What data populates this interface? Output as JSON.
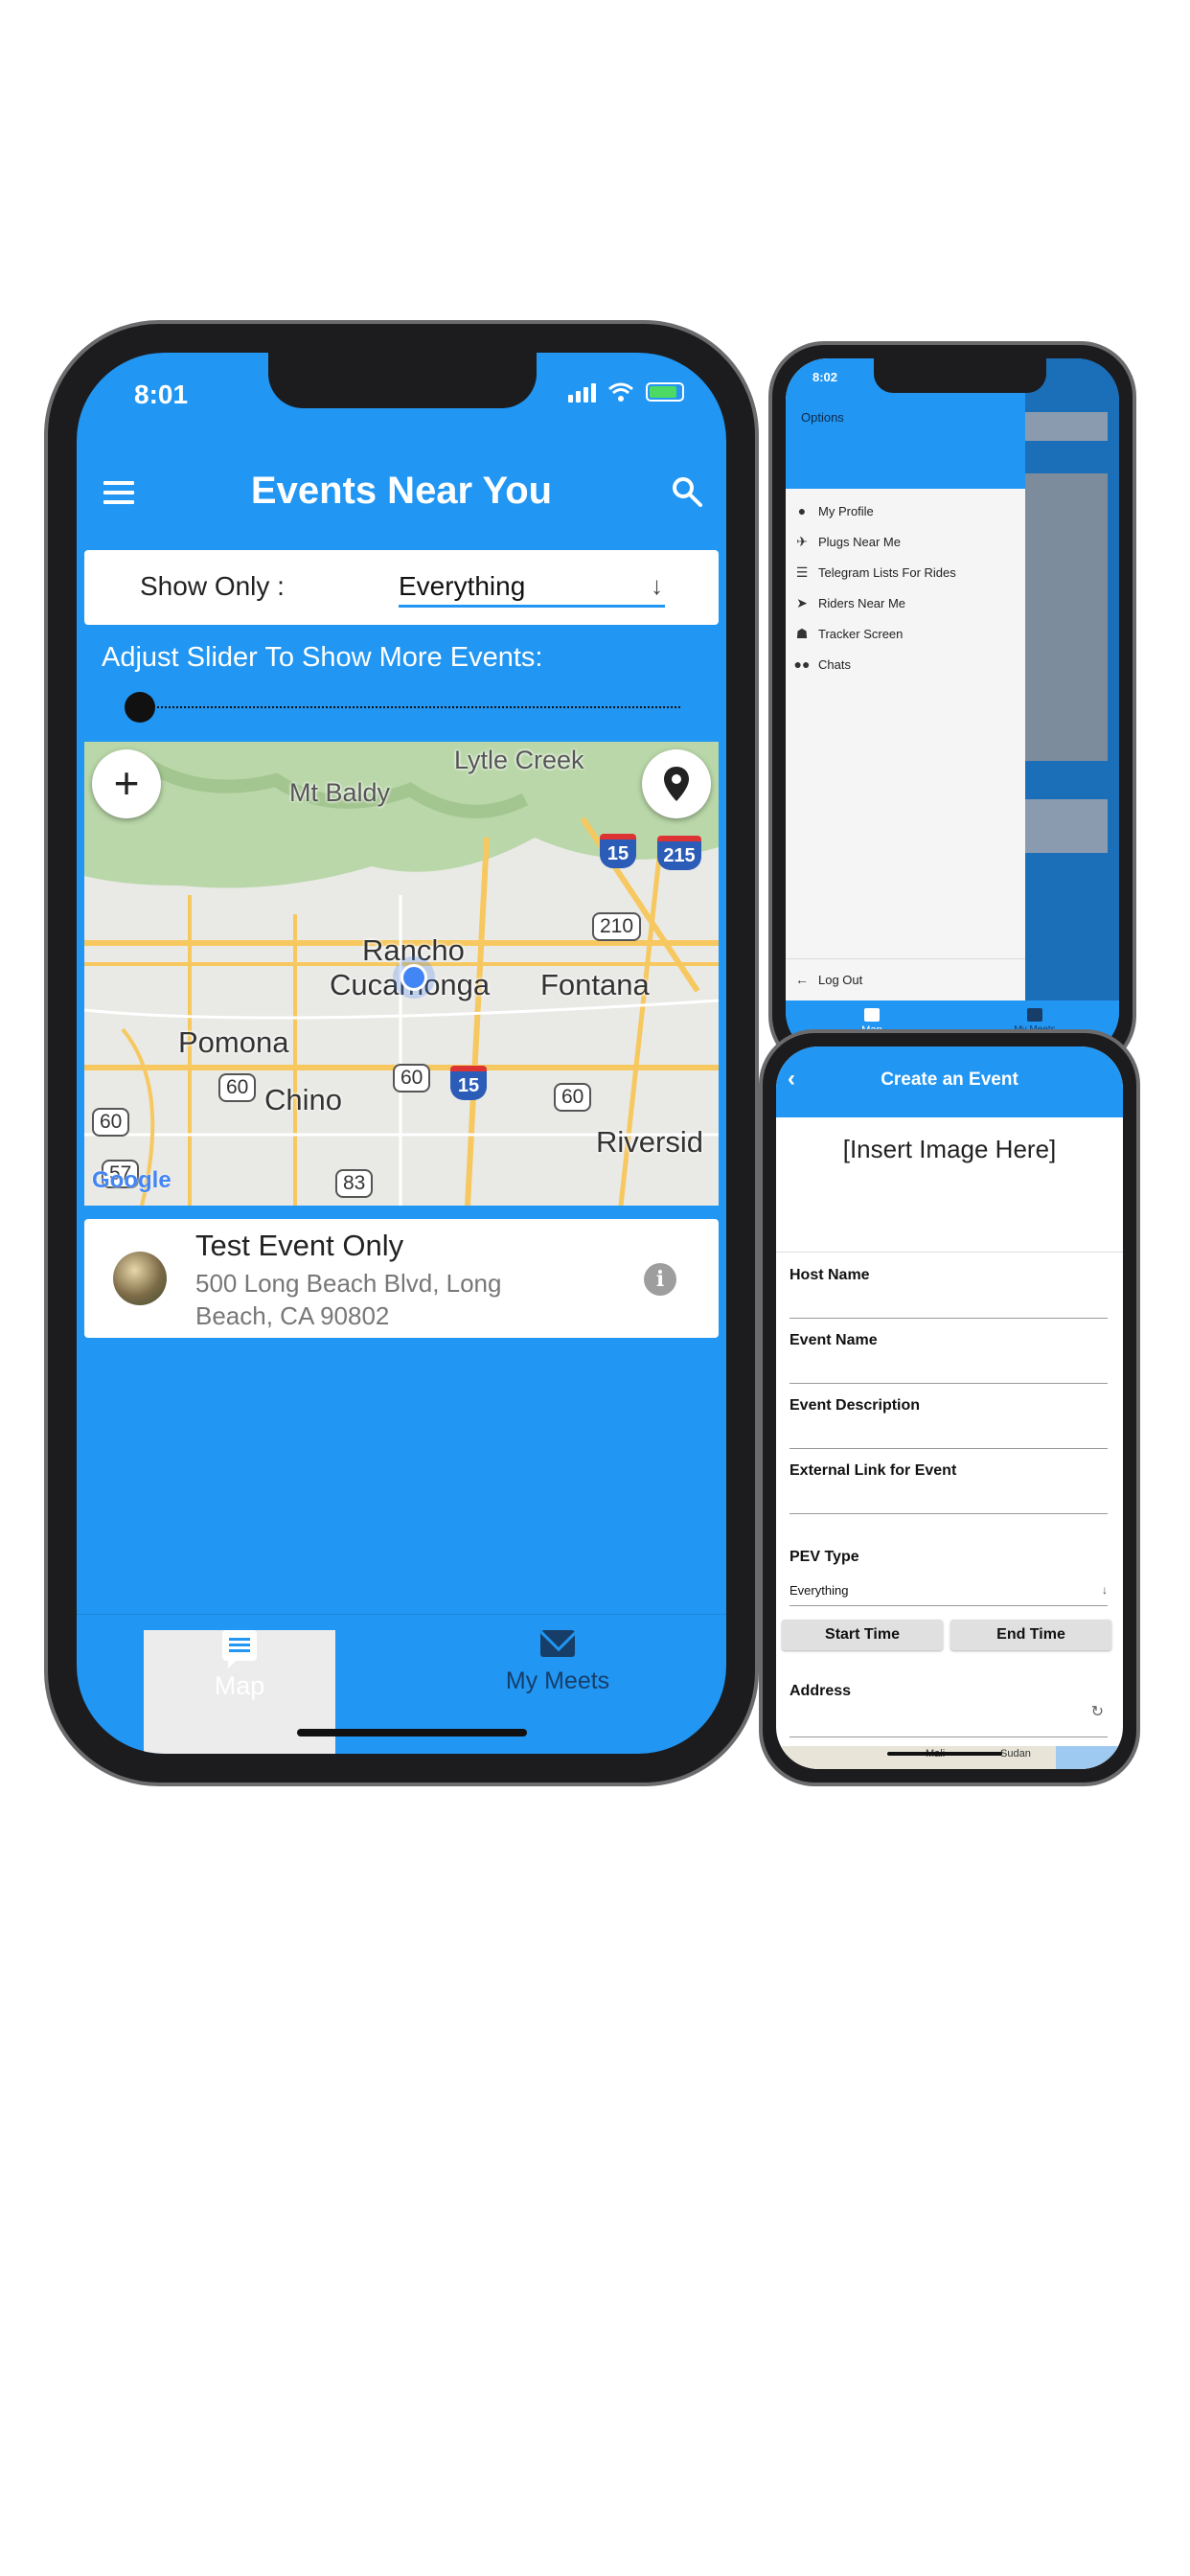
{
  "main_phone": {
    "status": {
      "time": "8:01"
    },
    "appbar": {
      "title": "Events Near You"
    },
    "filter": {
      "label": "Show Only :",
      "value": "Everything"
    },
    "slider": {
      "label": "Adjust Slider To Show More Events:",
      "level": 0
    },
    "map": {
      "labels": {
        "mt_baldy": "Mt Baldy",
        "lytle_creek": "Lytle Creek",
        "rancho": "Rancho",
        "cucamonga": "Cucamonga",
        "fontana": "Fontana",
        "pomona": "Pomona",
        "chino": "Chino",
        "riverside": "Riversid"
      },
      "shields": {
        "i15_top": "15",
        "i215": "215",
        "r210": "210",
        "r60_a": "60",
        "r60_b": "60",
        "i15_mid": "15",
        "r60_c": "60",
        "r60_d": "60",
        "r57": "57",
        "r83": "83"
      },
      "attribution": "Google"
    },
    "event": {
      "title": "Test Event Only",
      "address": "500 Long Beach Blvd, Long Beach, CA 90802"
    },
    "bottom_nav": [
      {
        "label": "Map",
        "icon": "chat-icon",
        "active": true
      },
      {
        "label": "My Meets",
        "icon": "mail-icon",
        "active": false
      }
    ]
  },
  "drawer_phone": {
    "status": {
      "time": "8:02"
    },
    "header": "Options",
    "items": [
      {
        "label": "My Profile",
        "icon": "person-icon"
      },
      {
        "label": "Plugs Near Me",
        "icon": "airplane-icon"
      },
      {
        "label": "Telegram Lists For Rides",
        "icon": "list-icon"
      },
      {
        "label": "Riders Near Me",
        "icon": "navigation-icon"
      },
      {
        "label": "Tracker Screen",
        "icon": "running-icon"
      },
      {
        "label": "Chats",
        "icon": "group-icon"
      }
    ],
    "logout": "Log Out",
    "bottom_nav": [
      {
        "label": "Map"
      },
      {
        "label": "My Meets"
      }
    ]
  },
  "create_phone": {
    "title": "Create an Event",
    "image_placeholder": "[Insert Image Here]",
    "fields": [
      {
        "label": "Host Name"
      },
      {
        "label": "Event Name"
      },
      {
        "label": "Event Description"
      },
      {
        "label": "External Link for Event"
      }
    ],
    "pev_type": {
      "label": "PEV Type",
      "value": "Everything"
    },
    "start_time": "Start Time",
    "end_time": "End Time",
    "address_label": "Address",
    "map_labels": {
      "mali": "Mali",
      "sudan": "Sudan"
    }
  },
  "colors": {
    "primary": "#2196F3",
    "nav_inactive": "#173e68",
    "card": "#ffffff",
    "text_secondary": "#777777"
  }
}
